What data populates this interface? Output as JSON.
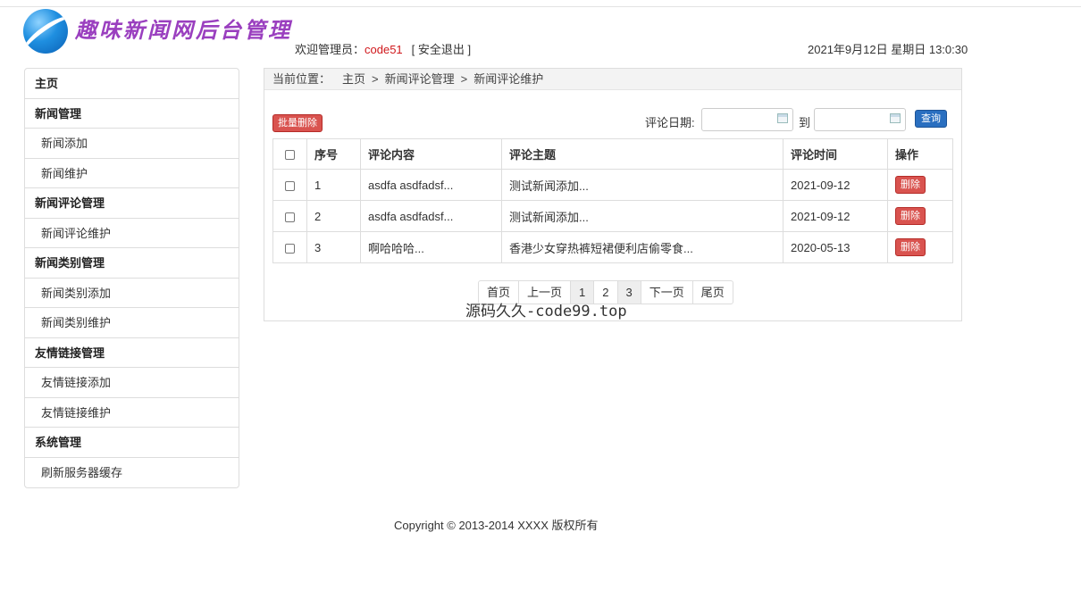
{
  "header": {
    "logo_text": "趣味新闻网后台管理",
    "welcome_prefix": "欢迎管理员：",
    "username": "code51",
    "logout": "[ 安全退出 ]",
    "datetime": "2021年9月12日 星期日 13:0:30"
  },
  "sidebar": {
    "rows": [
      {
        "label": "主页",
        "type": "category"
      },
      {
        "label": "新闻管理",
        "type": "category"
      },
      {
        "label": "新闻添加",
        "type": "item"
      },
      {
        "label": "新闻维护",
        "type": "item"
      },
      {
        "label": "新闻评论管理",
        "type": "category"
      },
      {
        "label": "新闻评论维护",
        "type": "item"
      },
      {
        "label": "新闻类别管理",
        "type": "category"
      },
      {
        "label": "新闻类别添加",
        "type": "item"
      },
      {
        "label": "新闻类别维护",
        "type": "item"
      },
      {
        "label": "友情链接管理",
        "type": "category"
      },
      {
        "label": "友情链接添加",
        "type": "item"
      },
      {
        "label": "友情链接维护",
        "type": "item"
      },
      {
        "label": "系统管理",
        "type": "category"
      },
      {
        "label": "刷新服务器缓存",
        "type": "item"
      }
    ]
  },
  "breadcrumb": {
    "label": "当前位置：",
    "items": [
      "主页",
      "新闻评论管理",
      "新闻评论维护"
    ],
    "separator": ">"
  },
  "toolbar": {
    "batch_delete": "批量删除",
    "date_label": "评论日期:",
    "to_label": "到",
    "date_from": "",
    "date_to": "",
    "search": "查询"
  },
  "table": {
    "headers": [
      "序号",
      "评论内容",
      "评论主题",
      "评论时间",
      "操作"
    ],
    "rows": [
      {
        "no": "1",
        "content": "asdfa asdfadsf...",
        "topic": "测试新闻添加...",
        "time": "2021-09-12",
        "action": "删除"
      },
      {
        "no": "2",
        "content": "asdfa asdfadsf...",
        "topic": "测试新闻添加...",
        "time": "2021-09-12",
        "action": "删除"
      },
      {
        "no": "3",
        "content": "啊哈哈哈...",
        "topic": "香港少女穿热裤短裙便利店偷零食...",
        "time": "2020-05-13",
        "action": "删除"
      }
    ]
  },
  "pagination": {
    "first": "首页",
    "prev": "上一页",
    "pages": [
      "1",
      "2",
      "3"
    ],
    "next": "下一页",
    "last": "尾页"
  },
  "watermark": "源码久久-code99.top",
  "footer": "Copyright © 2013-2014 XXXX 版权所有"
}
